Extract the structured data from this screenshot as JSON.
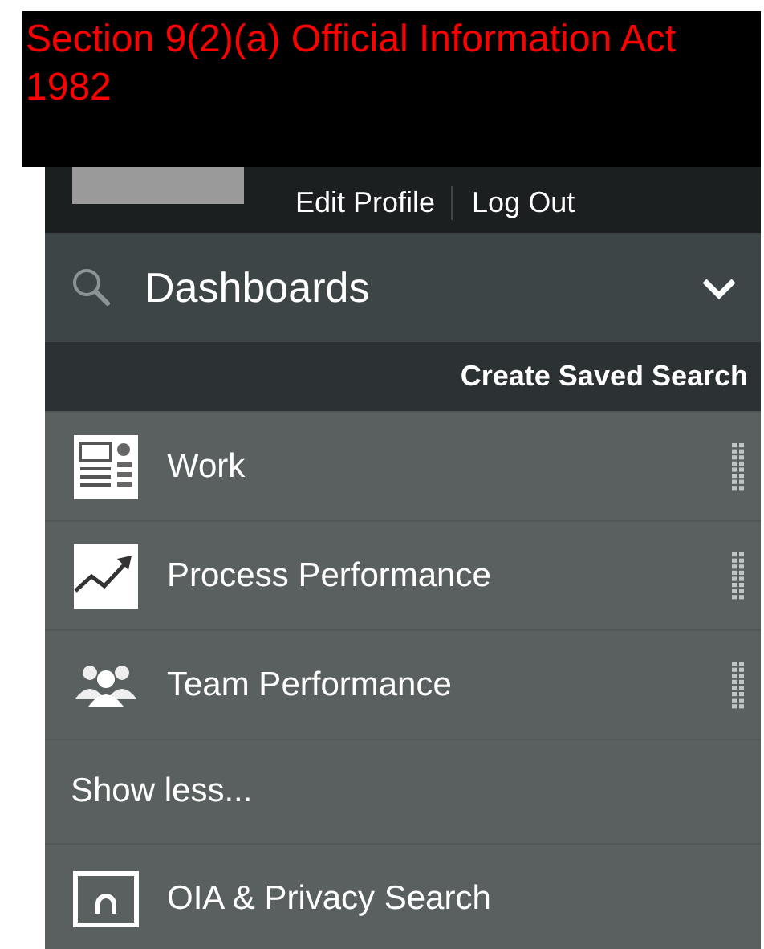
{
  "redaction": {
    "text": "Section 9(2)(a) Official Information Act 1982"
  },
  "profile": {
    "links": [
      "Edit Profile",
      "Log Out"
    ]
  },
  "section": {
    "title": "Dashboards",
    "expanded": true,
    "action": "Create Saved Search"
  },
  "items": [
    {
      "label": "Work",
      "kind": "work",
      "reorderable": true
    },
    {
      "label": "Process Performance",
      "kind": "trend",
      "reorderable": true
    },
    {
      "label": "Team Performance",
      "kind": "team",
      "reorderable": true
    },
    {
      "label": "Show less...",
      "kind": "text",
      "reorderable": false
    },
    {
      "label": "OIA & Privacy Search",
      "kind": "search",
      "reorderable": false
    }
  ]
}
